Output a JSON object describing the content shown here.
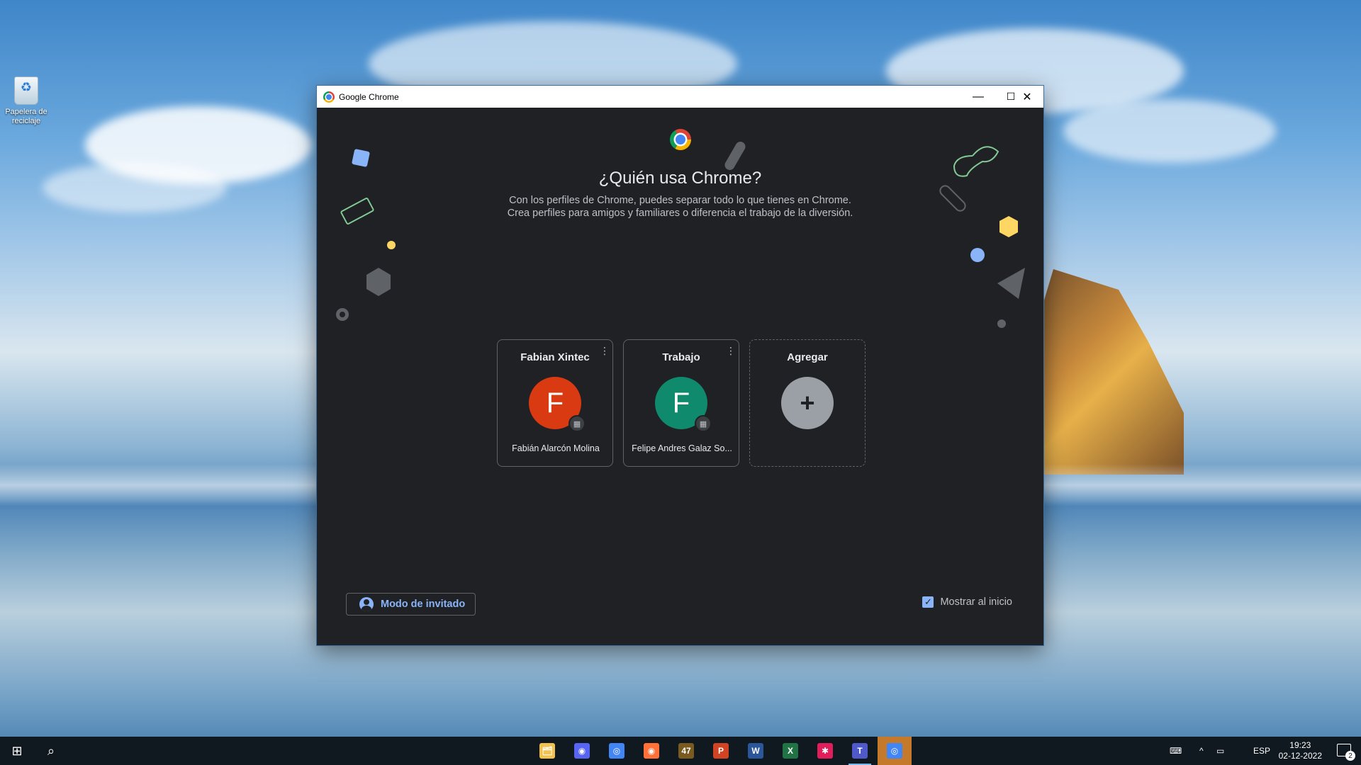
{
  "desktop": {
    "recycle_bin_label": "Papelera de reciclaje"
  },
  "window": {
    "title": "Google Chrome",
    "controls": {
      "minimize": "—",
      "maximize": "☐",
      "close": "✕"
    }
  },
  "picker": {
    "heading": "¿Quién usa Chrome?",
    "subtitle": "Con los perfiles de Chrome, puedes separar todo lo que tienes en Chrome. Crea perfiles para amigos y familiares o diferencia el trabajo de la diversión.",
    "profiles": [
      {
        "name": "Fabian Xintec",
        "initial": "F",
        "email": "Fabián Alarcón Molina",
        "color": "#d93a12"
      },
      {
        "name": "Trabajo",
        "initial": "F",
        "email": "Felipe Andres Galaz So...",
        "color": "#0f8a6c"
      }
    ],
    "add": {
      "label": "Agregar",
      "icon": "+"
    },
    "guest_mode_label": "Modo de invitado",
    "show_on_startup_label": "Mostrar al inicio",
    "show_on_startup_checked": true,
    "kebab_glyph": "⋮",
    "badge_glyph": "▦"
  },
  "taskbar": {
    "start_glyph": "⊞",
    "search_glyph": "⌕",
    "apps": [
      {
        "name": "file-explorer",
        "glyph": "🗂",
        "color": "#f2c14e"
      },
      {
        "name": "discord",
        "glyph": "◉",
        "color": "#5865f2"
      },
      {
        "name": "chrome",
        "glyph": "◎",
        "color": "#4285f4"
      },
      {
        "name": "firefox",
        "glyph": "◉",
        "color": "#ff7139"
      },
      {
        "name": "app-47",
        "glyph": "47",
        "color": "#7a5a1e"
      },
      {
        "name": "powerpoint",
        "glyph": "P",
        "color": "#d04423"
      },
      {
        "name": "word",
        "glyph": "W",
        "color": "#2b579a"
      },
      {
        "name": "excel",
        "glyph": "X",
        "color": "#217346"
      },
      {
        "name": "slack",
        "glyph": "✱",
        "color": "#e01e5a"
      },
      {
        "name": "teams",
        "glyph": "T",
        "color": "#5059c9"
      },
      {
        "name": "chrome-active",
        "glyph": "◎",
        "color": "#4285f4"
      }
    ],
    "tray": {
      "language": "ESP",
      "time": "19:23",
      "date": "02-12-2022",
      "notification_count": "2",
      "chevron": "^"
    }
  }
}
